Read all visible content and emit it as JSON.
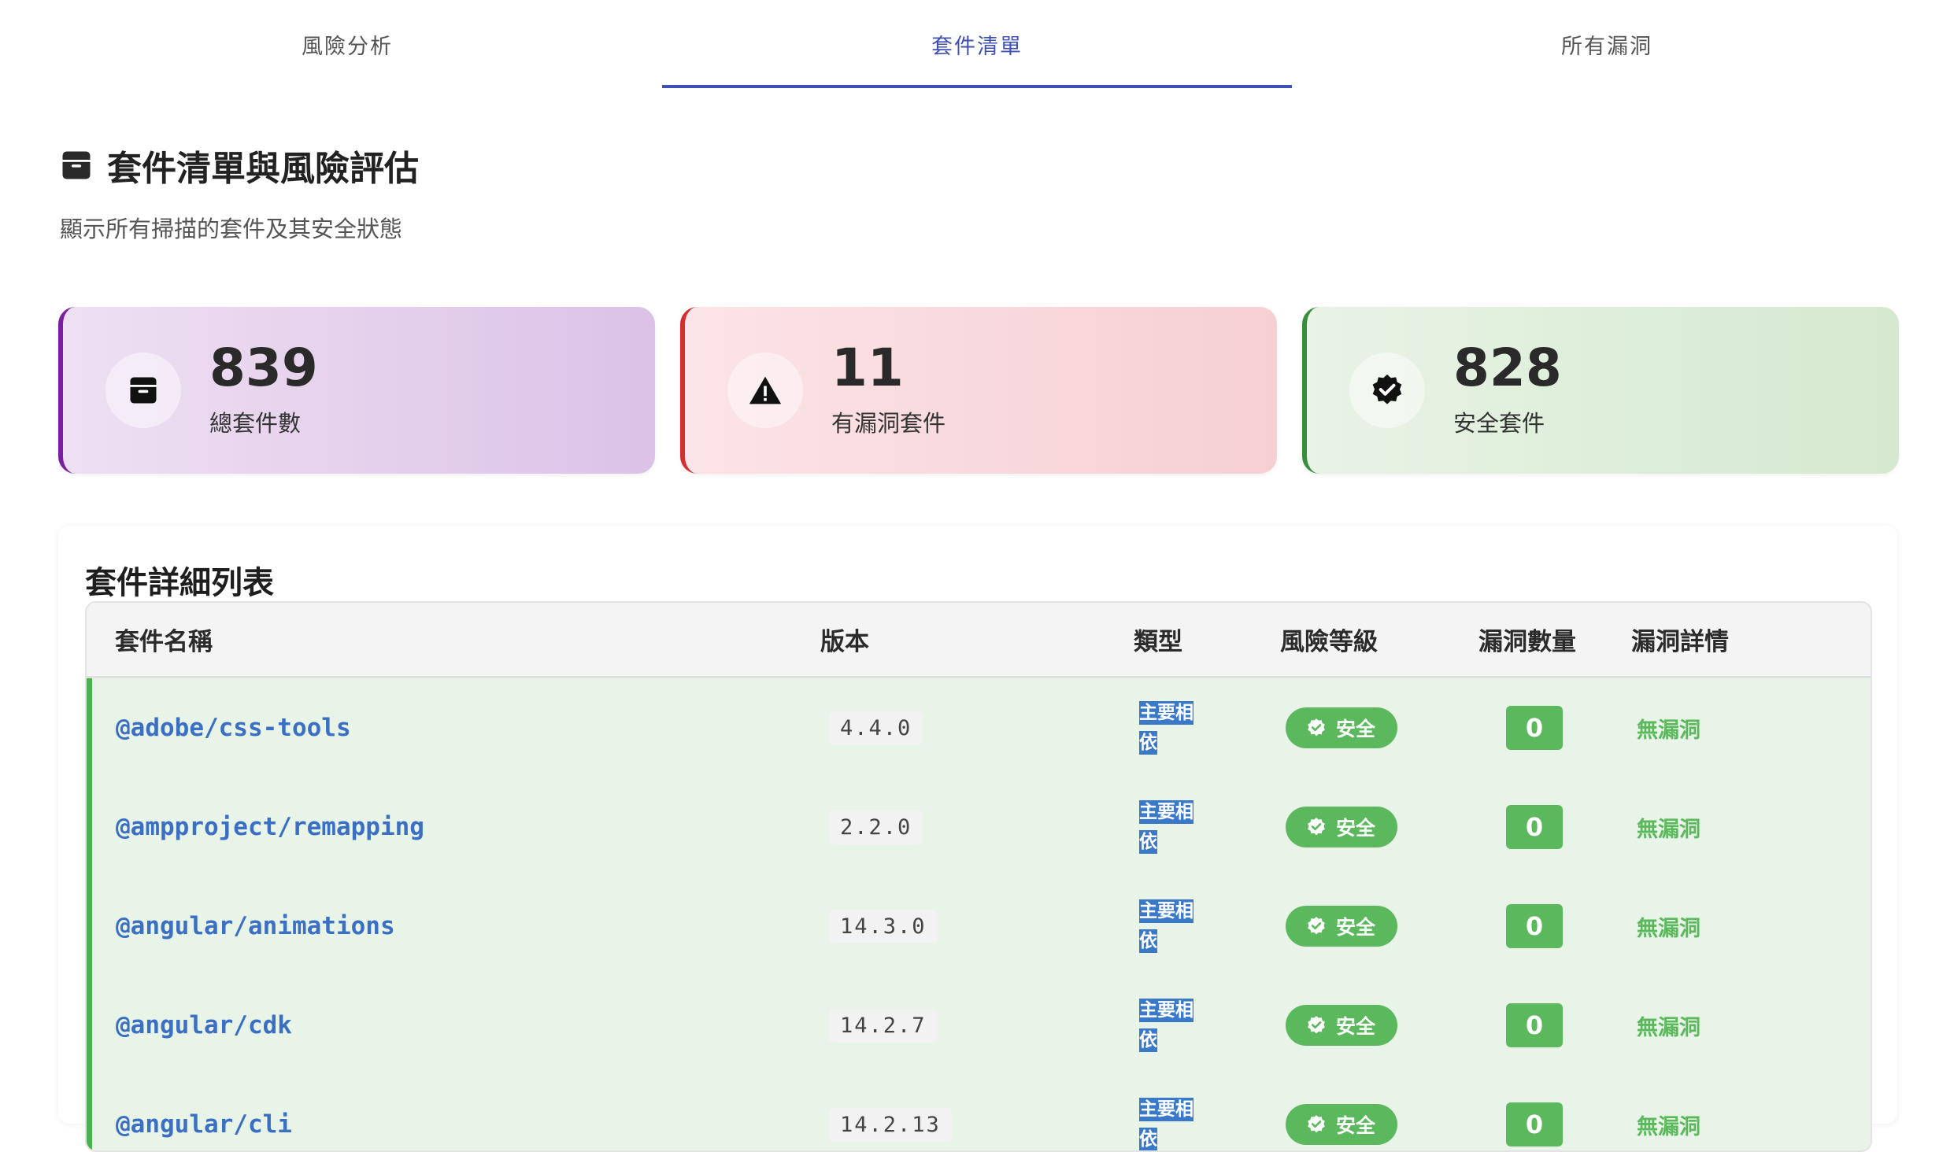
{
  "tabs": [
    {
      "label": "風險分析",
      "active": false
    },
    {
      "label": "套件清單",
      "active": true
    },
    {
      "label": "所有漏洞",
      "active": false
    }
  ],
  "header": {
    "title": "套件清單與風險評估",
    "title_icon": "archive-box-icon",
    "subtitle": "顯示所有掃描的套件及其安全狀態"
  },
  "stats": [
    {
      "value": "839",
      "label": "總套件數",
      "icon": "archive-box-icon",
      "accent": "#7b1fa2"
    },
    {
      "value": "11",
      "label": "有漏洞套件",
      "icon": "warning-triangle-icon",
      "accent": "#d32f2f"
    },
    {
      "value": "828",
      "label": "安全套件",
      "icon": "verified-badge-icon",
      "accent": "#388e3c"
    }
  ],
  "table": {
    "title": "套件詳細列表",
    "columns": [
      "套件名稱",
      "版本",
      "類型",
      "風險等級",
      "漏洞數量",
      "漏洞詳情"
    ],
    "rows": [
      {
        "name": "@adobe/css-tools",
        "version": "4.4.0",
        "type": "主要相依",
        "risk": "安全",
        "count": "0",
        "detail": "無漏洞"
      },
      {
        "name": "@ampproject/remapping",
        "version": "2.2.0",
        "type": "主要相依",
        "risk": "安全",
        "count": "0",
        "detail": "無漏洞"
      },
      {
        "name": "@angular/animations",
        "version": "14.3.0",
        "type": "主要相依",
        "risk": "安全",
        "count": "0",
        "detail": "無漏洞"
      },
      {
        "name": "@angular/cdk",
        "version": "14.2.7",
        "type": "主要相依",
        "risk": "安全",
        "count": "0",
        "detail": "無漏洞"
      },
      {
        "name": "@angular/cli",
        "version": "14.2.13",
        "type": "主要相依",
        "risk": "安全",
        "count": "0",
        "detail": "無漏洞"
      }
    ]
  },
  "colors": {
    "accent": "#3f51b5",
    "safe": "#5cb85c",
    "link": "#3a6fc4",
    "type_badge": "#3a78c9"
  }
}
